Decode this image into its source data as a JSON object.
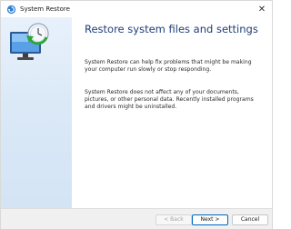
{
  "window": {
    "title": "System Restore",
    "close_glyph": "✕",
    "title_icon": "system-restore-icon"
  },
  "sidepanel": {
    "hero_icon": "restore-monitor-icon"
  },
  "content": {
    "heading": "Restore system files and settings",
    "paragraph1": "System Restore can help fix problems that might be making your computer run slowly or stop responding.",
    "paragraph2": "System Restore does not affect any of your documents, pictures, or other personal data. Recently installed programs and drivers might be uninstalled."
  },
  "buttons": {
    "back": "< Back",
    "next": "Next >",
    "cancel": "Cancel"
  },
  "colors": {
    "heading": "#1f3f77",
    "accent": "#0067c0",
    "sidepanel": "#dbe9f7"
  }
}
